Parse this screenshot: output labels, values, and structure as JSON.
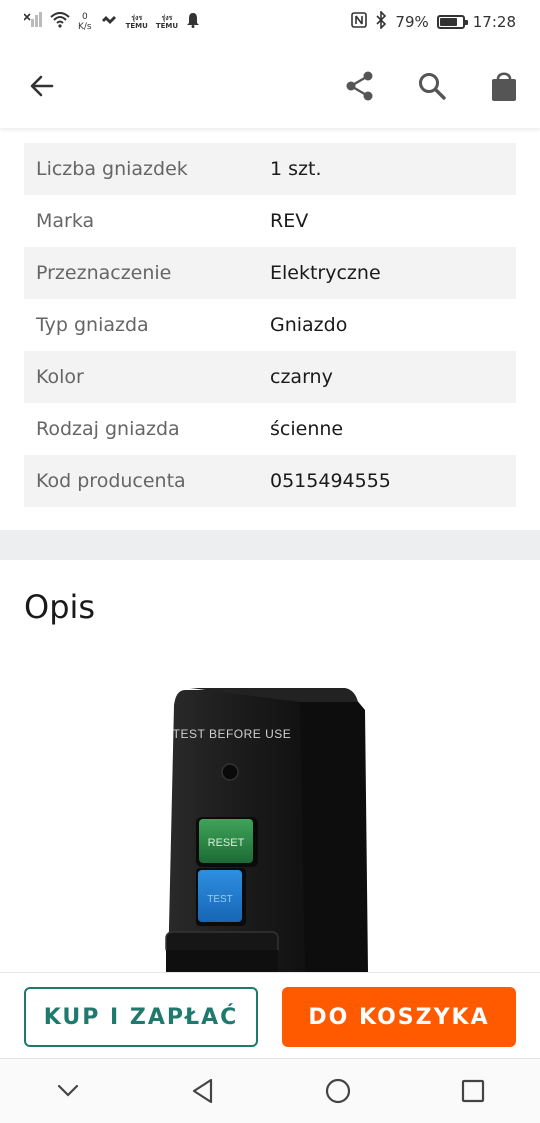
{
  "status_bar": {
    "speed_value": "0",
    "speed_unit": "K/s",
    "logo_1_top": "รุ่งร",
    "logo_1_bottom": "TEMU",
    "logo_2_top": "รุ่งร",
    "logo_2_bottom": "TEMU",
    "battery_percent": "79%",
    "battery_level": 0.79,
    "time": "17:28"
  },
  "app_bar": {
    "back_icon": "arrow-left",
    "share_icon": "share",
    "search_icon": "search",
    "bag_icon": "shopping-bag"
  },
  "attributes": [
    {
      "key": "Liczba gniazdek",
      "value": "1 szt."
    },
    {
      "key": "Marka",
      "value": "REV"
    },
    {
      "key": "Przeznaczenie",
      "value": "Elektryczne"
    },
    {
      "key": "Typ gniazda",
      "value": "Gniazdo"
    },
    {
      "key": "Kolor",
      "value": "czarny"
    },
    {
      "key": "Rodzaj gniazda",
      "value": "ścienne"
    },
    {
      "key": "Kod producenta",
      "value": "0515494555"
    }
  ],
  "description": {
    "title": "Opis",
    "image": {
      "label_test": "TEST BEFORE USE",
      "label_reset": "RESET",
      "label_test_button": "TEST"
    }
  },
  "actions": {
    "buy_label": "KUP I ZAPŁAĆ",
    "cart_label": "DO KOSZYKA"
  },
  "colors": {
    "accent_teal": "#1f7a6d",
    "accent_orange": "#ff5a00",
    "row_shade": "#f3f3f4"
  }
}
